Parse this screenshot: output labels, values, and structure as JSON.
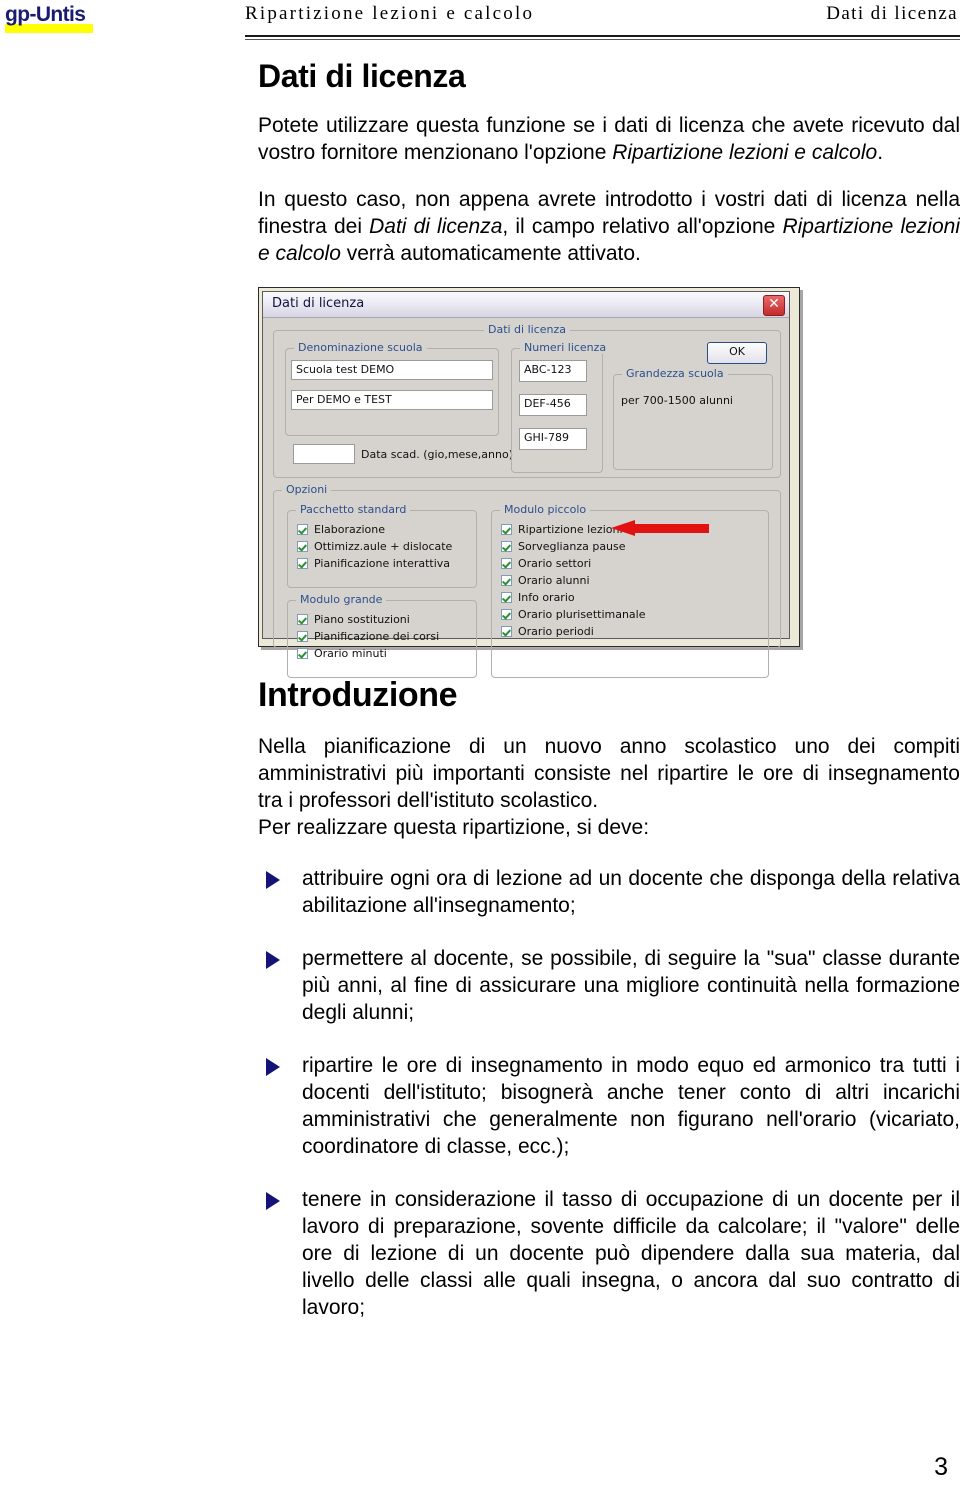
{
  "header": {
    "logo": "gp-Untis",
    "center_title": "Ripartizione lezioni e calcolo",
    "right_title": "Dati di licenza"
  },
  "page_number": "3",
  "sections": {
    "license": {
      "title": "Dati di licenza",
      "paragraph1_a": "Potete utilizzare questa funzione se i dati di licenza che avete ricevuto dal vostro fornitore menzionano l'opzione ",
      "paragraph1_italic": "Ripartizione lezioni e calcolo",
      "paragraph1_b": ".",
      "paragraph2_a": "In questo caso, non appena avrete introdotto i vostri dati di licenza nella finestra dei ",
      "paragraph2_italic1": "Dati di licenza",
      "paragraph2_b": ", il campo relativo all'opzione ",
      "paragraph2_italic2": "Ripartizione lezioni e calcolo",
      "paragraph2_c": " verrà automaticamente attivato."
    },
    "intro": {
      "title": "Introduzione",
      "paragraph1": "Nella pianificazione di un nuovo anno scolastico uno dei compiti amministrativi più importanti consiste nel ripartire le ore di insegnamento tra i professori dell'istituto scolastico.",
      "paragraph2": "Per realizzare questa ripartizione, si deve:",
      "bullets": [
        "attribuire ogni ora di lezione ad un docente che disponga della relativa abilitazione all'insegnamento;",
        "permettere al docente, se possibile, di seguire la \"sua\" classe durante più anni, al fine di assicurare una migliore continuità nella formazione degli alunni;",
        "ripartire le ore di insegnamento in modo equo ed armonico tra tutti i docenti dell'istituto; bisognerà anche tener conto di altri incarichi amministrativi che generalmente non figurano nell'orario (vicariato, coordinatore di classe, ecc.);",
        "tenere in considerazione il tasso di occupazione di un docente per il lavoro di preparazione, sovente difficile da calcolare; il \"valore\" delle ore di lezione di un docente può dipendere dalla sua materia, dal livello delle classi alle quali insegna, o ancora dal suo contratto di lavoro;"
      ]
    }
  },
  "dialog": {
    "title": "Dati di licenza",
    "close_icon": "close-icon",
    "outer_group_label": "Dati di licenza",
    "school_name_group": "Denominazione scuola",
    "school_name_line1": "Scuola test  DEMO",
    "school_name_line2": "Per DEMO e TEST",
    "expiry_field_value": "",
    "expiry_label": "Data scad. (gio,mese,anno)",
    "license_numbers_group": "Numeri licenza",
    "license_numbers": [
      "ABC-123",
      "DEF-456",
      "GHI-789"
    ],
    "school_size_group": "Grandezza scuola",
    "school_size_value": "per 700-1500 alunni",
    "ok_label": "OK",
    "options_group": "Opzioni",
    "standard_package_group": "Pacchetto standard",
    "standard_package_items": [
      "Elaborazione",
      "Ottimizz.aule + dislocate",
      "Pianificazione interattiva"
    ],
    "large_module_group": "Modulo grande",
    "large_module_items": [
      "Piano sostituzioni",
      "Pianificazione dei corsi",
      "Orario minuti"
    ],
    "small_module_group": "Modulo piccolo",
    "small_module_items": [
      "Ripartizione lezioni e calcolo",
      "Sorveglianza pause",
      "Orario settori",
      "Orario alunni",
      "Info orario",
      "Orario plurisettimanale",
      "Orario periodi"
    ],
    "annotation_arrow": "red-left-arrow",
    "colors": {
      "dialog_face": "#d6d3ce",
      "group_label": "#2b4f8e",
      "arrow_red": "#e21212",
      "check_green": "#2f8f2f"
    }
  },
  "colors": {
    "logo_blue": "#1b1b6f",
    "logo_highlight": "#ffff00",
    "bullet_navy": "#141478"
  }
}
